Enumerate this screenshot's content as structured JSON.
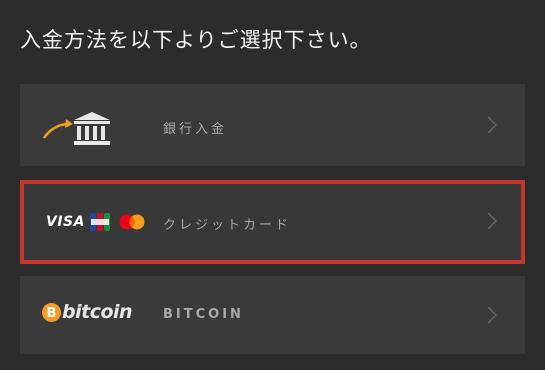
{
  "heading": "入金方法を以下よりご選択下さい。",
  "options": [
    {
      "id": "bank",
      "label": "銀行入金",
      "icon": "bank-transfer-icon",
      "selected": false
    },
    {
      "id": "credit-card",
      "label": "クレジットカード",
      "icons": [
        "visa-logo",
        "jcb-logo",
        "mastercard-logo"
      ],
      "visa_text": "VISA",
      "selected": true
    },
    {
      "id": "bitcoin",
      "label": "BITCOIN",
      "icon": "bitcoin-logo",
      "bitcoin_text": "bitcoin",
      "selected": false
    }
  ],
  "colors": {
    "background": "#2c2c2c",
    "option_background": "#3a3a3a",
    "selection_border": "#c0392b",
    "bitcoin_orange": "#f39c26",
    "arrow_gold": "#f0a020"
  }
}
